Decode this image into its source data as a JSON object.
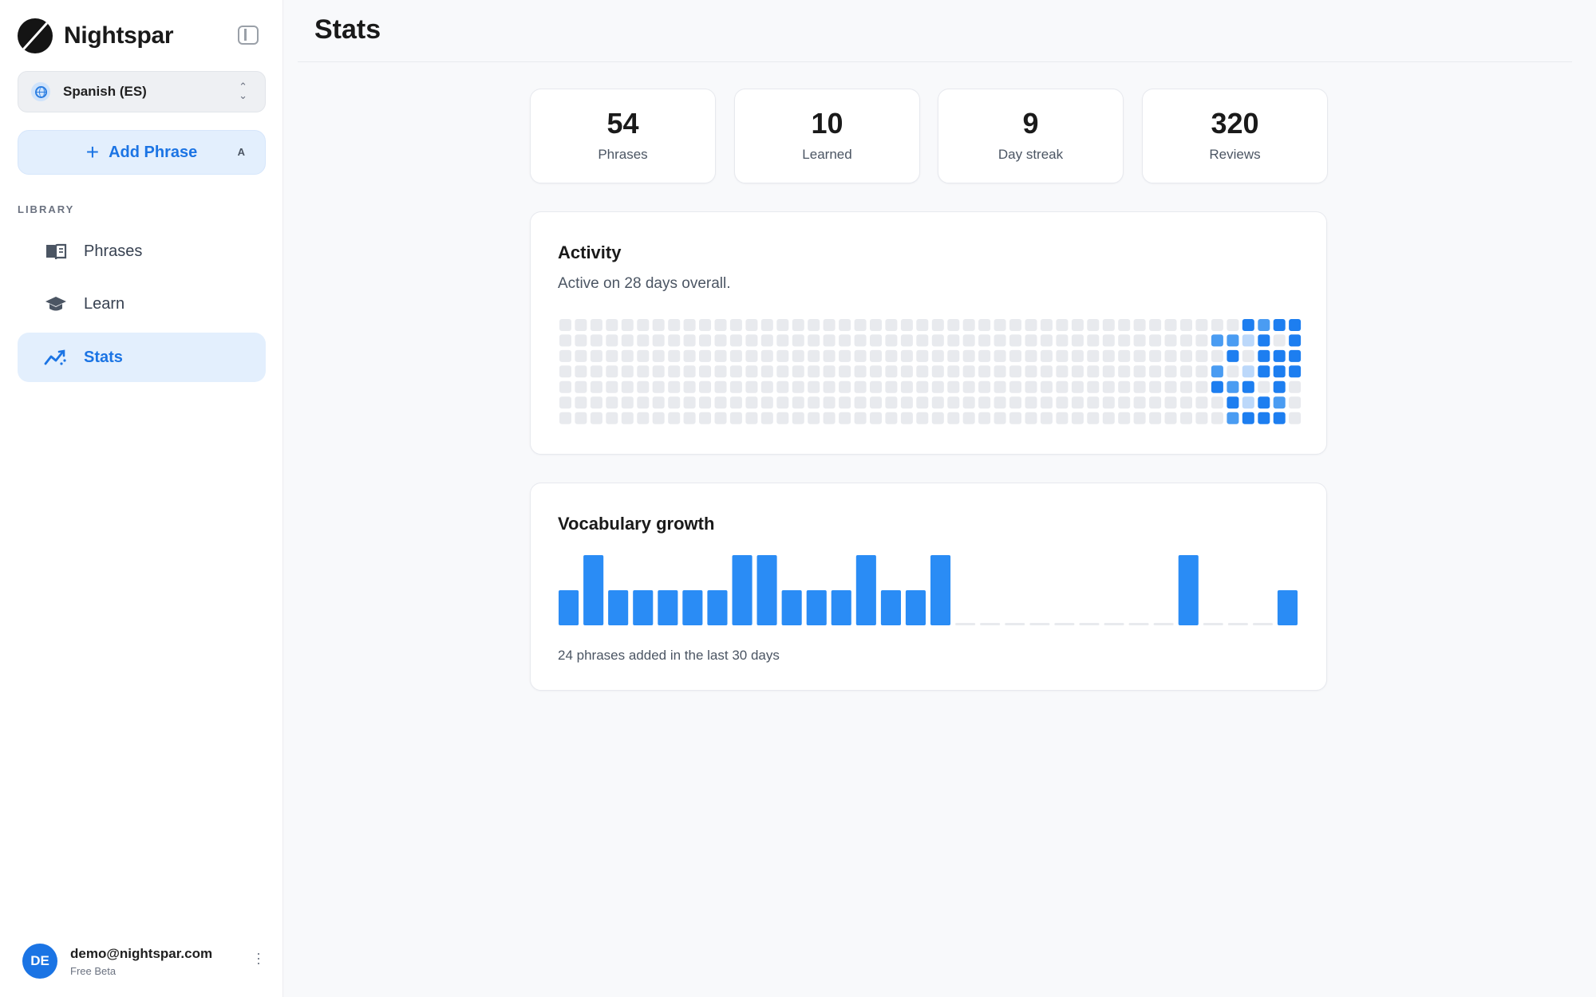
{
  "app": {
    "name": "Nightspar"
  },
  "language_selector": {
    "label": "Spanish (ES)"
  },
  "add_phrase": {
    "label": "Add Phrase",
    "shortcut": "A"
  },
  "sidebar": {
    "section_label": "LIBRARY",
    "items": [
      {
        "label": "Phrases",
        "icon": "book-icon",
        "active": false
      },
      {
        "label": "Learn",
        "icon": "graduation-cap-icon",
        "active": false
      },
      {
        "label": "Stats",
        "icon": "trending-chart-icon",
        "active": true
      }
    ]
  },
  "user": {
    "initials": "DE",
    "email": "demo@nightspar.com",
    "plan": "Free Beta"
  },
  "page": {
    "title": "Stats"
  },
  "stats": [
    {
      "value": "54",
      "label": "Phrases"
    },
    {
      "value": "10",
      "label": "Learned"
    },
    {
      "value": "9",
      "label": "Day streak"
    },
    {
      "value": "320",
      "label": "Reviews"
    }
  ],
  "activity": {
    "title": "Activity",
    "summary": "Active on 28 days overall."
  },
  "colors": {
    "accent": "#1b74e4",
    "bar": "#2a8cf5",
    "cell_empty": "#e8eaee",
    "cell_level1": "#bcd8fa",
    "cell_level2": "#4a9cf2",
    "cell_level3": "#1d7ef0",
    "bar_empty": "#e8eaee"
  },
  "chart_data": [
    {
      "type": "heatmap",
      "title": "Activity",
      "rows": 7,
      "columns": 48,
      "active_cells": [
        [
          0,
          44,
          3
        ],
        [
          0,
          45,
          2
        ],
        [
          0,
          46,
          3
        ],
        [
          0,
          47,
          3
        ],
        [
          1,
          42,
          2
        ],
        [
          1,
          43,
          2
        ],
        [
          1,
          44,
          1
        ],
        [
          1,
          45,
          3
        ],
        [
          1,
          47,
          3
        ],
        [
          2,
          43,
          3
        ],
        [
          2,
          45,
          3
        ],
        [
          2,
          46,
          3
        ],
        [
          2,
          47,
          3
        ],
        [
          3,
          42,
          2
        ],
        [
          3,
          44,
          1
        ],
        [
          3,
          45,
          3
        ],
        [
          3,
          46,
          3
        ],
        [
          3,
          47,
          3
        ],
        [
          4,
          42,
          3
        ],
        [
          4,
          43,
          2
        ],
        [
          4,
          44,
          3
        ],
        [
          4,
          46,
          3
        ],
        [
          5,
          43,
          3
        ],
        [
          5,
          44,
          1
        ],
        [
          5,
          45,
          3
        ],
        [
          5,
          46,
          2
        ],
        [
          6,
          43,
          2
        ],
        [
          6,
          44,
          3
        ],
        [
          6,
          45,
          3
        ],
        [
          6,
          46,
          3
        ]
      ]
    },
    {
      "type": "bar",
      "title": "Vocabulary growth",
      "caption": "24 phrases added in the last 30 days",
      "values": [
        1,
        2,
        1,
        1,
        1,
        1,
        1,
        2,
        2,
        1,
        1,
        1,
        2,
        1,
        1,
        2,
        0,
        0,
        0,
        0,
        0,
        0,
        0,
        0,
        0,
        2,
        0,
        0,
        0,
        1
      ],
      "ylim": [
        0,
        2
      ]
    }
  ]
}
